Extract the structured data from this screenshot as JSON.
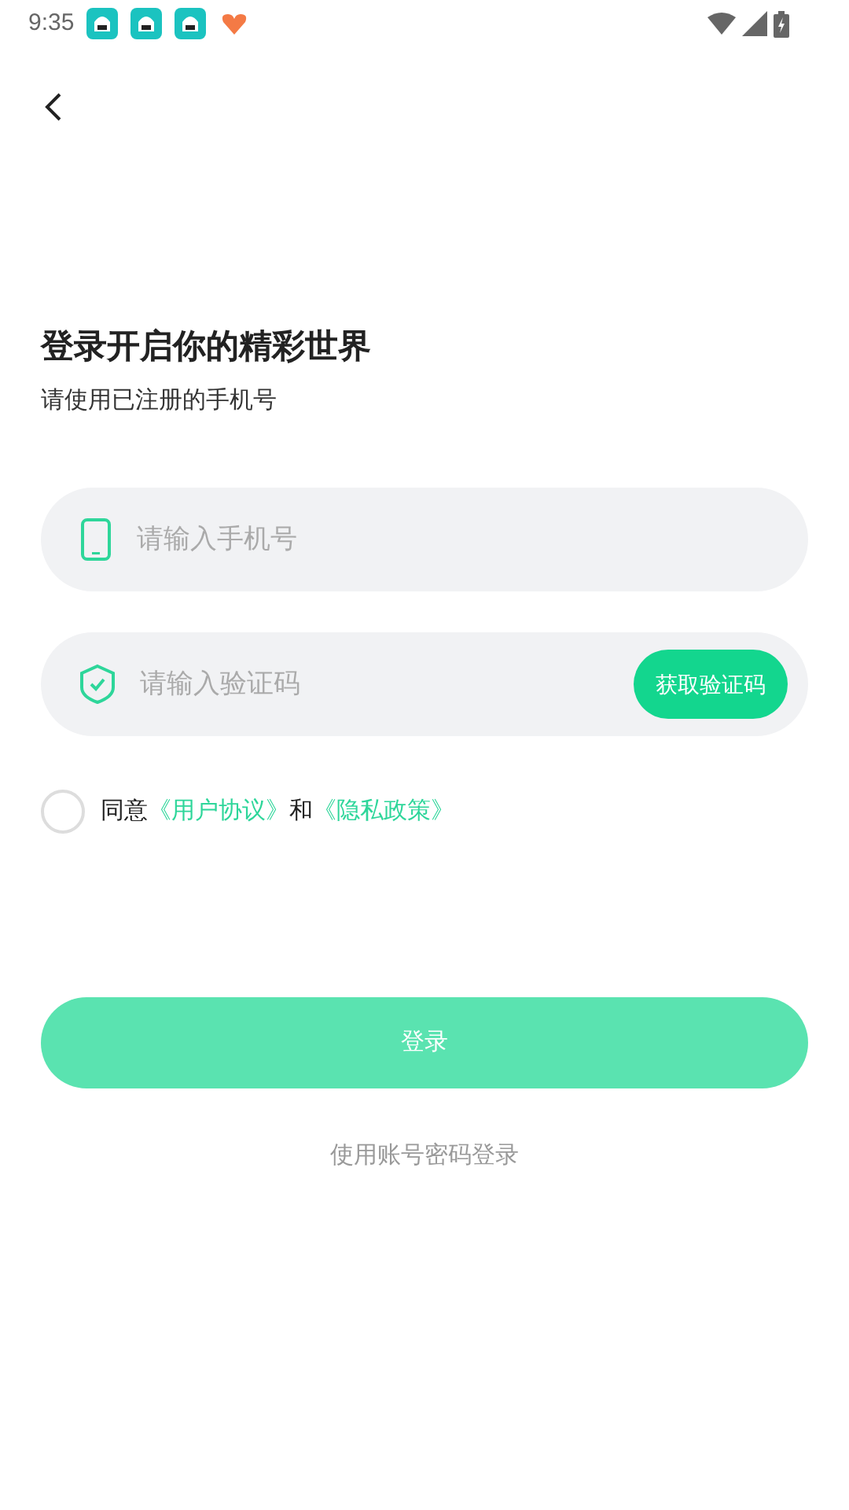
{
  "status_bar": {
    "time": "9:35"
  },
  "title": "登录开启你的精彩世界",
  "subtitle": "请使用已注册的手机号",
  "phone_field": {
    "placeholder": "请输入手机号"
  },
  "code_field": {
    "placeholder": "请输入验证码",
    "button": "获取验证码"
  },
  "agreement": {
    "checked": false,
    "parts": [
      {
        "kind": "text",
        "text": "同意"
      },
      {
        "kind": "link",
        "text": "《用户协议》"
      },
      {
        "kind": "text",
        "text": "和"
      },
      {
        "kind": "link",
        "text": "《隐私政策》"
      }
    ]
  },
  "login_button": {
    "label": "登录",
    "disabled": true
  },
  "alt_login": "使用账号密码登录"
}
